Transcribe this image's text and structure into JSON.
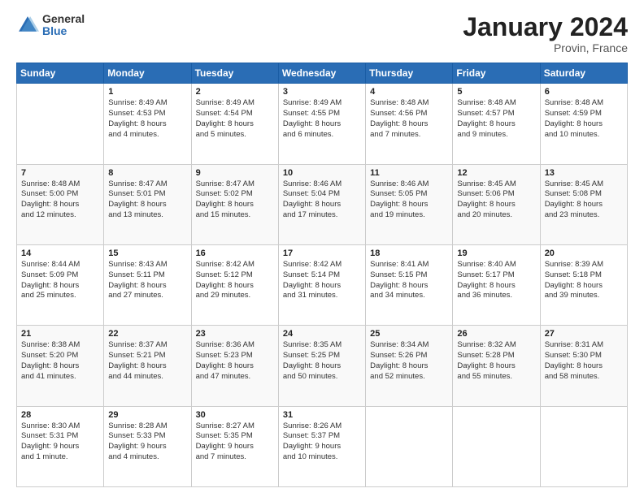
{
  "logo": {
    "general": "General",
    "blue": "Blue"
  },
  "header": {
    "month": "January 2024",
    "location": "Provin, France"
  },
  "days_of_week": [
    "Sunday",
    "Monday",
    "Tuesday",
    "Wednesday",
    "Thursday",
    "Friday",
    "Saturday"
  ],
  "weeks": [
    [
      {
        "day": "",
        "info": ""
      },
      {
        "day": "1",
        "info": "Sunrise: 8:49 AM\nSunset: 4:53 PM\nDaylight: 8 hours\nand 4 minutes."
      },
      {
        "day": "2",
        "info": "Sunrise: 8:49 AM\nSunset: 4:54 PM\nDaylight: 8 hours\nand 5 minutes."
      },
      {
        "day": "3",
        "info": "Sunrise: 8:49 AM\nSunset: 4:55 PM\nDaylight: 8 hours\nand 6 minutes."
      },
      {
        "day": "4",
        "info": "Sunrise: 8:48 AM\nSunset: 4:56 PM\nDaylight: 8 hours\nand 7 minutes."
      },
      {
        "day": "5",
        "info": "Sunrise: 8:48 AM\nSunset: 4:57 PM\nDaylight: 8 hours\nand 9 minutes."
      },
      {
        "day": "6",
        "info": "Sunrise: 8:48 AM\nSunset: 4:59 PM\nDaylight: 8 hours\nand 10 minutes."
      }
    ],
    [
      {
        "day": "7",
        "info": "Sunrise: 8:48 AM\nSunset: 5:00 PM\nDaylight: 8 hours\nand 12 minutes."
      },
      {
        "day": "8",
        "info": "Sunrise: 8:47 AM\nSunset: 5:01 PM\nDaylight: 8 hours\nand 13 minutes."
      },
      {
        "day": "9",
        "info": "Sunrise: 8:47 AM\nSunset: 5:02 PM\nDaylight: 8 hours\nand 15 minutes."
      },
      {
        "day": "10",
        "info": "Sunrise: 8:46 AM\nSunset: 5:04 PM\nDaylight: 8 hours\nand 17 minutes."
      },
      {
        "day": "11",
        "info": "Sunrise: 8:46 AM\nSunset: 5:05 PM\nDaylight: 8 hours\nand 19 minutes."
      },
      {
        "day": "12",
        "info": "Sunrise: 8:45 AM\nSunset: 5:06 PM\nDaylight: 8 hours\nand 20 minutes."
      },
      {
        "day": "13",
        "info": "Sunrise: 8:45 AM\nSunset: 5:08 PM\nDaylight: 8 hours\nand 23 minutes."
      }
    ],
    [
      {
        "day": "14",
        "info": "Sunrise: 8:44 AM\nSunset: 5:09 PM\nDaylight: 8 hours\nand 25 minutes."
      },
      {
        "day": "15",
        "info": "Sunrise: 8:43 AM\nSunset: 5:11 PM\nDaylight: 8 hours\nand 27 minutes."
      },
      {
        "day": "16",
        "info": "Sunrise: 8:42 AM\nSunset: 5:12 PM\nDaylight: 8 hours\nand 29 minutes."
      },
      {
        "day": "17",
        "info": "Sunrise: 8:42 AM\nSunset: 5:14 PM\nDaylight: 8 hours\nand 31 minutes."
      },
      {
        "day": "18",
        "info": "Sunrise: 8:41 AM\nSunset: 5:15 PM\nDaylight: 8 hours\nand 34 minutes."
      },
      {
        "day": "19",
        "info": "Sunrise: 8:40 AM\nSunset: 5:17 PM\nDaylight: 8 hours\nand 36 minutes."
      },
      {
        "day": "20",
        "info": "Sunrise: 8:39 AM\nSunset: 5:18 PM\nDaylight: 8 hours\nand 39 minutes."
      }
    ],
    [
      {
        "day": "21",
        "info": "Sunrise: 8:38 AM\nSunset: 5:20 PM\nDaylight: 8 hours\nand 41 minutes."
      },
      {
        "day": "22",
        "info": "Sunrise: 8:37 AM\nSunset: 5:21 PM\nDaylight: 8 hours\nand 44 minutes."
      },
      {
        "day": "23",
        "info": "Sunrise: 8:36 AM\nSunset: 5:23 PM\nDaylight: 8 hours\nand 47 minutes."
      },
      {
        "day": "24",
        "info": "Sunrise: 8:35 AM\nSunset: 5:25 PM\nDaylight: 8 hours\nand 50 minutes."
      },
      {
        "day": "25",
        "info": "Sunrise: 8:34 AM\nSunset: 5:26 PM\nDaylight: 8 hours\nand 52 minutes."
      },
      {
        "day": "26",
        "info": "Sunrise: 8:32 AM\nSunset: 5:28 PM\nDaylight: 8 hours\nand 55 minutes."
      },
      {
        "day": "27",
        "info": "Sunrise: 8:31 AM\nSunset: 5:30 PM\nDaylight: 8 hours\nand 58 minutes."
      }
    ],
    [
      {
        "day": "28",
        "info": "Sunrise: 8:30 AM\nSunset: 5:31 PM\nDaylight: 9 hours\nand 1 minute."
      },
      {
        "day": "29",
        "info": "Sunrise: 8:28 AM\nSunset: 5:33 PM\nDaylight: 9 hours\nand 4 minutes."
      },
      {
        "day": "30",
        "info": "Sunrise: 8:27 AM\nSunset: 5:35 PM\nDaylight: 9 hours\nand 7 minutes."
      },
      {
        "day": "31",
        "info": "Sunrise: 8:26 AM\nSunset: 5:37 PM\nDaylight: 9 hours\nand 10 minutes."
      },
      {
        "day": "",
        "info": ""
      },
      {
        "day": "",
        "info": ""
      },
      {
        "day": "",
        "info": ""
      }
    ]
  ]
}
